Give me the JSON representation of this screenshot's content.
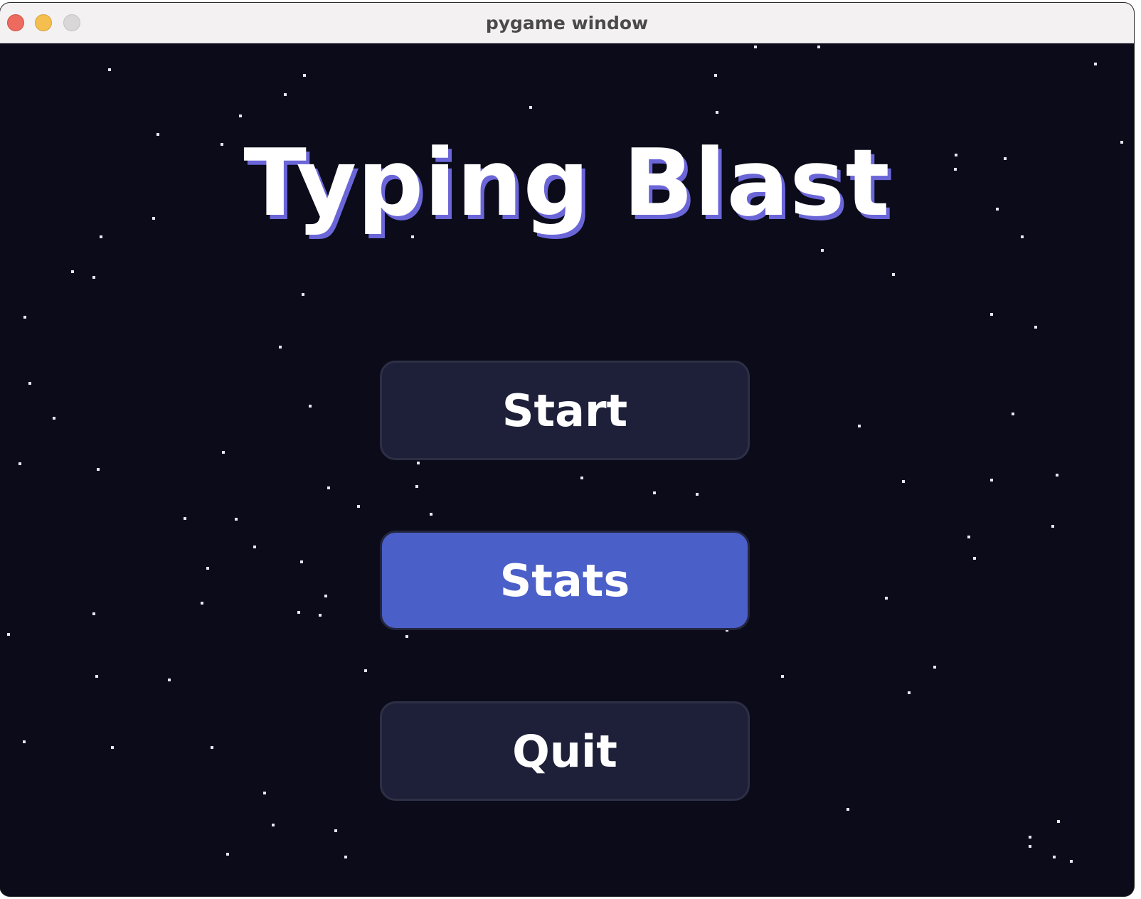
{
  "window": {
    "title": "pygame window"
  },
  "game": {
    "title": "Typing Blast",
    "menu": {
      "start_label": "Start",
      "stats_label": "Stats",
      "quit_label": "Quit",
      "selected": "Stats"
    }
  },
  "colors": {
    "background": "#0b0b1a",
    "button": "#1e203a",
    "button_active": "#4b5fc9",
    "title_shadow": "#6b66d8",
    "star": "#e6e6f5"
  }
}
